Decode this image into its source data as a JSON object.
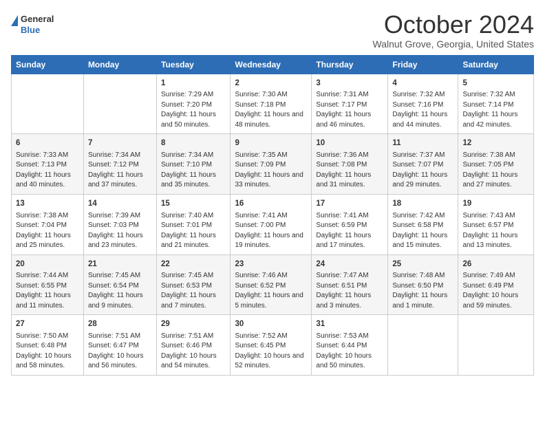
{
  "header": {
    "logo_line1": "General",
    "logo_line2": "Blue",
    "month": "October 2024",
    "location": "Walnut Grove, Georgia, United States"
  },
  "days_of_week": [
    "Sunday",
    "Monday",
    "Tuesday",
    "Wednesday",
    "Thursday",
    "Friday",
    "Saturday"
  ],
  "weeks": [
    [
      {
        "day": "",
        "info": ""
      },
      {
        "day": "",
        "info": ""
      },
      {
        "day": "1",
        "info": "Sunrise: 7:29 AM\nSunset: 7:20 PM\nDaylight: 11 hours and 50 minutes."
      },
      {
        "day": "2",
        "info": "Sunrise: 7:30 AM\nSunset: 7:18 PM\nDaylight: 11 hours and 48 minutes."
      },
      {
        "day": "3",
        "info": "Sunrise: 7:31 AM\nSunset: 7:17 PM\nDaylight: 11 hours and 46 minutes."
      },
      {
        "day": "4",
        "info": "Sunrise: 7:32 AM\nSunset: 7:16 PM\nDaylight: 11 hours and 44 minutes."
      },
      {
        "day": "5",
        "info": "Sunrise: 7:32 AM\nSunset: 7:14 PM\nDaylight: 11 hours and 42 minutes."
      }
    ],
    [
      {
        "day": "6",
        "info": "Sunrise: 7:33 AM\nSunset: 7:13 PM\nDaylight: 11 hours and 40 minutes."
      },
      {
        "day": "7",
        "info": "Sunrise: 7:34 AM\nSunset: 7:12 PM\nDaylight: 11 hours and 37 minutes."
      },
      {
        "day": "8",
        "info": "Sunrise: 7:34 AM\nSunset: 7:10 PM\nDaylight: 11 hours and 35 minutes."
      },
      {
        "day": "9",
        "info": "Sunrise: 7:35 AM\nSunset: 7:09 PM\nDaylight: 11 hours and 33 minutes."
      },
      {
        "day": "10",
        "info": "Sunrise: 7:36 AM\nSunset: 7:08 PM\nDaylight: 11 hours and 31 minutes."
      },
      {
        "day": "11",
        "info": "Sunrise: 7:37 AM\nSunset: 7:07 PM\nDaylight: 11 hours and 29 minutes."
      },
      {
        "day": "12",
        "info": "Sunrise: 7:38 AM\nSunset: 7:05 PM\nDaylight: 11 hours and 27 minutes."
      }
    ],
    [
      {
        "day": "13",
        "info": "Sunrise: 7:38 AM\nSunset: 7:04 PM\nDaylight: 11 hours and 25 minutes."
      },
      {
        "day": "14",
        "info": "Sunrise: 7:39 AM\nSunset: 7:03 PM\nDaylight: 11 hours and 23 minutes."
      },
      {
        "day": "15",
        "info": "Sunrise: 7:40 AM\nSunset: 7:01 PM\nDaylight: 11 hours and 21 minutes."
      },
      {
        "day": "16",
        "info": "Sunrise: 7:41 AM\nSunset: 7:00 PM\nDaylight: 11 hours and 19 minutes."
      },
      {
        "day": "17",
        "info": "Sunrise: 7:41 AM\nSunset: 6:59 PM\nDaylight: 11 hours and 17 minutes."
      },
      {
        "day": "18",
        "info": "Sunrise: 7:42 AM\nSunset: 6:58 PM\nDaylight: 11 hours and 15 minutes."
      },
      {
        "day": "19",
        "info": "Sunrise: 7:43 AM\nSunset: 6:57 PM\nDaylight: 11 hours and 13 minutes."
      }
    ],
    [
      {
        "day": "20",
        "info": "Sunrise: 7:44 AM\nSunset: 6:55 PM\nDaylight: 11 hours and 11 minutes."
      },
      {
        "day": "21",
        "info": "Sunrise: 7:45 AM\nSunset: 6:54 PM\nDaylight: 11 hours and 9 minutes."
      },
      {
        "day": "22",
        "info": "Sunrise: 7:45 AM\nSunset: 6:53 PM\nDaylight: 11 hours and 7 minutes."
      },
      {
        "day": "23",
        "info": "Sunrise: 7:46 AM\nSunset: 6:52 PM\nDaylight: 11 hours and 5 minutes."
      },
      {
        "day": "24",
        "info": "Sunrise: 7:47 AM\nSunset: 6:51 PM\nDaylight: 11 hours and 3 minutes."
      },
      {
        "day": "25",
        "info": "Sunrise: 7:48 AM\nSunset: 6:50 PM\nDaylight: 11 hours and 1 minute."
      },
      {
        "day": "26",
        "info": "Sunrise: 7:49 AM\nSunset: 6:49 PM\nDaylight: 10 hours and 59 minutes."
      }
    ],
    [
      {
        "day": "27",
        "info": "Sunrise: 7:50 AM\nSunset: 6:48 PM\nDaylight: 10 hours and 58 minutes."
      },
      {
        "day": "28",
        "info": "Sunrise: 7:51 AM\nSunset: 6:47 PM\nDaylight: 10 hours and 56 minutes."
      },
      {
        "day": "29",
        "info": "Sunrise: 7:51 AM\nSunset: 6:46 PM\nDaylight: 10 hours and 54 minutes."
      },
      {
        "day": "30",
        "info": "Sunrise: 7:52 AM\nSunset: 6:45 PM\nDaylight: 10 hours and 52 minutes."
      },
      {
        "day": "31",
        "info": "Sunrise: 7:53 AM\nSunset: 6:44 PM\nDaylight: 10 hours and 50 minutes."
      },
      {
        "day": "",
        "info": ""
      },
      {
        "day": "",
        "info": ""
      }
    ]
  ]
}
